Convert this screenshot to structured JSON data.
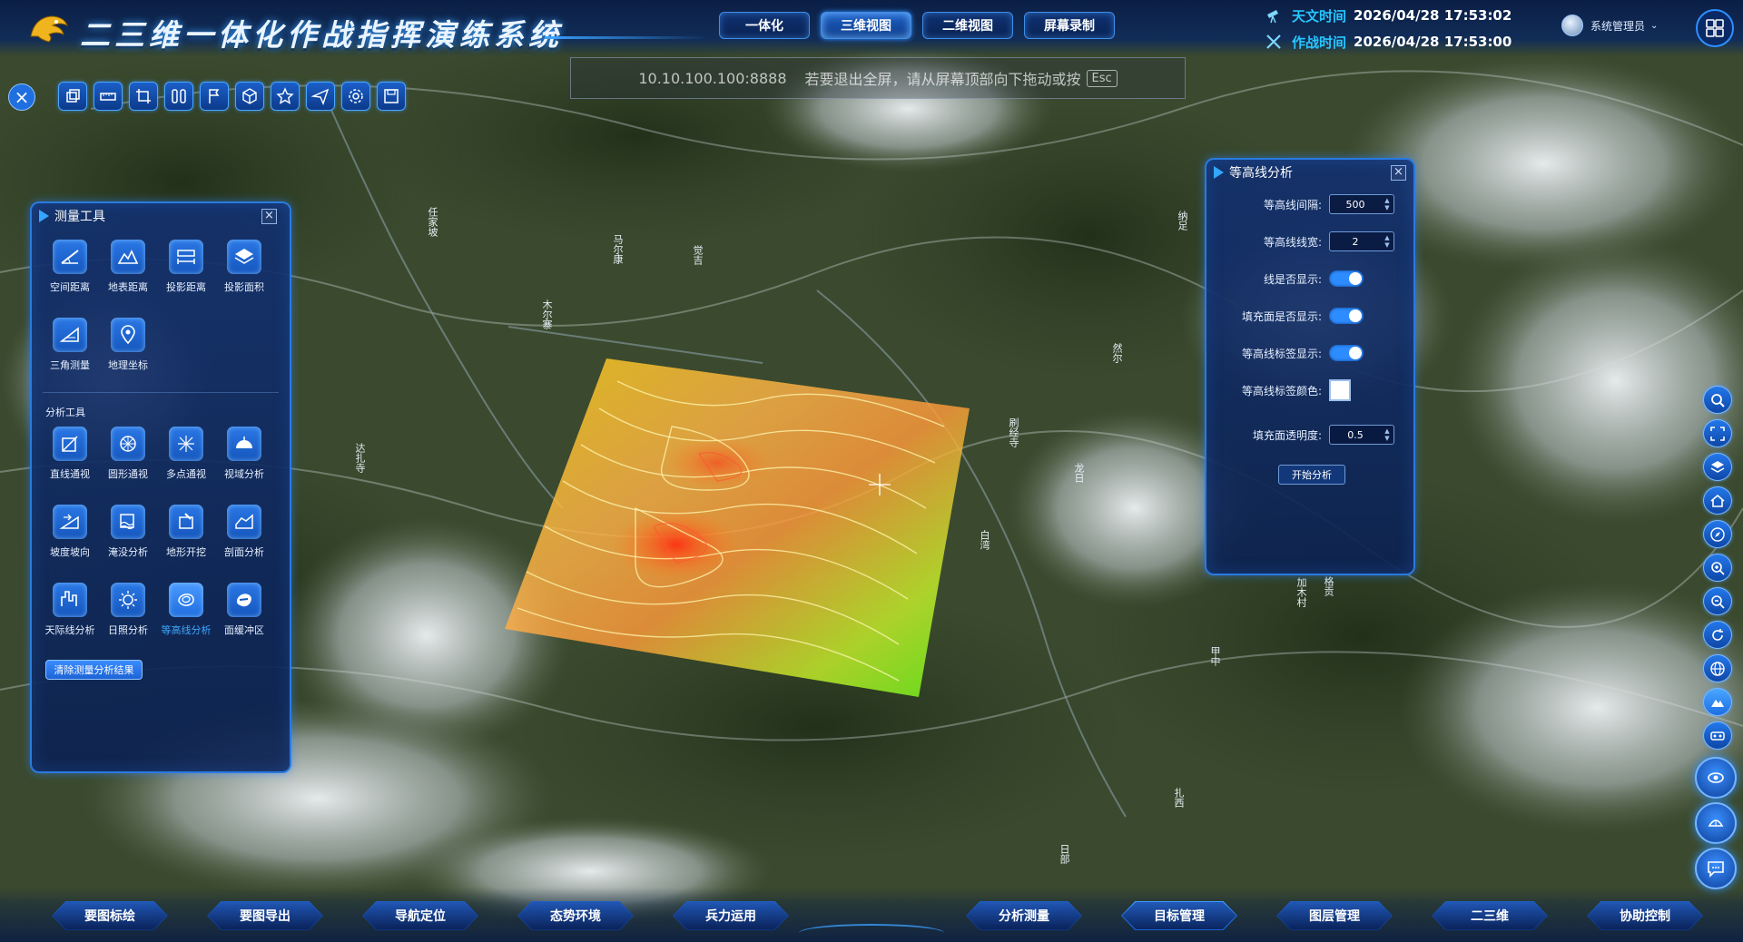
{
  "header": {
    "title": "二三维一体化作战指挥演练系统",
    "view_tabs": [
      {
        "label": "一体化",
        "active": false
      },
      {
        "label": "三维视图",
        "active": true
      },
      {
        "label": "二维视图",
        "active": false
      },
      {
        "label": "屏幕录制",
        "active": false
      }
    ],
    "astro_time_label": "天文时间",
    "astro_time_value": "2026/04/28 17:53:02",
    "battle_time_label": "作战时间",
    "battle_time_value": "2026/04/28 17:53:00",
    "user_name": "系统管理员"
  },
  "fullscreen_notice": {
    "address": "10.10.100.100:8888",
    "message": "若要退出全屏，请从屏幕顶部向下拖动或按",
    "key": "Esc"
  },
  "toolbar": {
    "icons": [
      "layers-icon",
      "ruler-icon",
      "crop-icon",
      "split-icon",
      "flag-icon",
      "cube-icon",
      "star-icon",
      "send-icon",
      "gear-icon",
      "save-icon"
    ]
  },
  "measure_panel": {
    "title": "测量工具",
    "measure_tools": [
      {
        "label": "空间距离",
        "icon": "space-distance-icon"
      },
      {
        "label": "地表距离",
        "icon": "surface-distance-icon"
      },
      {
        "label": "投影距离",
        "icon": "projection-distance-icon"
      },
      {
        "label": "投影面积",
        "icon": "projection-area-icon"
      },
      {
        "label": "三角测量",
        "icon": "triangle-measure-icon"
      },
      {
        "label": "地理坐标",
        "icon": "geo-coordinate-icon"
      }
    ],
    "analysis_label": "分析工具",
    "analysis_tools": [
      {
        "label": "直线通视",
        "icon": "line-of-sight-icon",
        "active": false
      },
      {
        "label": "圆形通视",
        "icon": "circle-sight-icon",
        "active": false
      },
      {
        "label": "多点通视",
        "icon": "multipoint-sight-icon",
        "active": false
      },
      {
        "label": "视域分析",
        "icon": "viewshed-icon",
        "active": false
      },
      {
        "label": "坡度坡向",
        "icon": "slope-icon",
        "active": false
      },
      {
        "label": "淹没分析",
        "icon": "flood-icon",
        "active": false
      },
      {
        "label": "地形开挖",
        "icon": "excavation-icon",
        "active": false
      },
      {
        "label": "剖面分析",
        "icon": "profile-icon",
        "active": false
      },
      {
        "label": "天际线分析",
        "icon": "skyline-icon",
        "active": false
      },
      {
        "label": "日照分析",
        "icon": "sunlight-icon",
        "active": false
      },
      {
        "label": "等高线分析",
        "icon": "contour-icon",
        "active": true
      },
      {
        "label": "面缓冲区",
        "icon": "buffer-icon",
        "active": false
      }
    ],
    "clear_button": "清除测量分析结果"
  },
  "contour_panel": {
    "title": "等高线分析",
    "interval_label": "等高线间隔:",
    "interval_value": "500",
    "width_label": "等高线线宽:",
    "width_value": "2",
    "line_visible_label": "线是否显示:",
    "line_visible": true,
    "fill_visible_label": "填充面是否显示:",
    "fill_visible": true,
    "label_visible_label": "等高线标签显示:",
    "label_visible": true,
    "label_color_label": "等高线标签颜色:",
    "label_color": "#ffffff",
    "opacity_label": "填充面透明度:",
    "opacity_value": "0.5",
    "start_button": "开始分析"
  },
  "right_rail": {
    "icons": [
      "search-icon",
      "fullscreen-icon",
      "layers-icon",
      "home-icon",
      "compass-icon",
      "zoom-in-icon",
      "zoom-out-icon",
      "refresh-icon",
      "globe-icon",
      "terrain-icon",
      "vr-icon"
    ]
  },
  "bottom_nav": [
    {
      "label": "要图标绘",
      "active": false
    },
    {
      "label": "要图导出",
      "active": false
    },
    {
      "label": "导航定位",
      "active": false
    },
    {
      "label": "态势环境",
      "active": false
    },
    {
      "label": "兵力运用",
      "active": false
    },
    {
      "label": "分析测量",
      "active": false
    },
    {
      "label": "目标管理",
      "active": true
    },
    {
      "label": "图层管理",
      "active": false
    },
    {
      "label": "二三维",
      "active": false
    },
    {
      "label": "协助控制",
      "active": false
    }
  ],
  "map_labels": [
    "任家坡",
    "马尔康",
    "刷经寺",
    "白湾",
    "甲中",
    "扎西",
    "格贡",
    "日部",
    "加木村",
    "觉吉",
    "然尔",
    "龙日",
    "纳足",
    "达扎寺",
    "木尔寨"
  ],
  "colors": {
    "accent": "#2d8cff",
    "panel_bg": "#12306e",
    "contour_fill_low": "#7cff00",
    "contour_fill_high": "#ff3b1a"
  }
}
